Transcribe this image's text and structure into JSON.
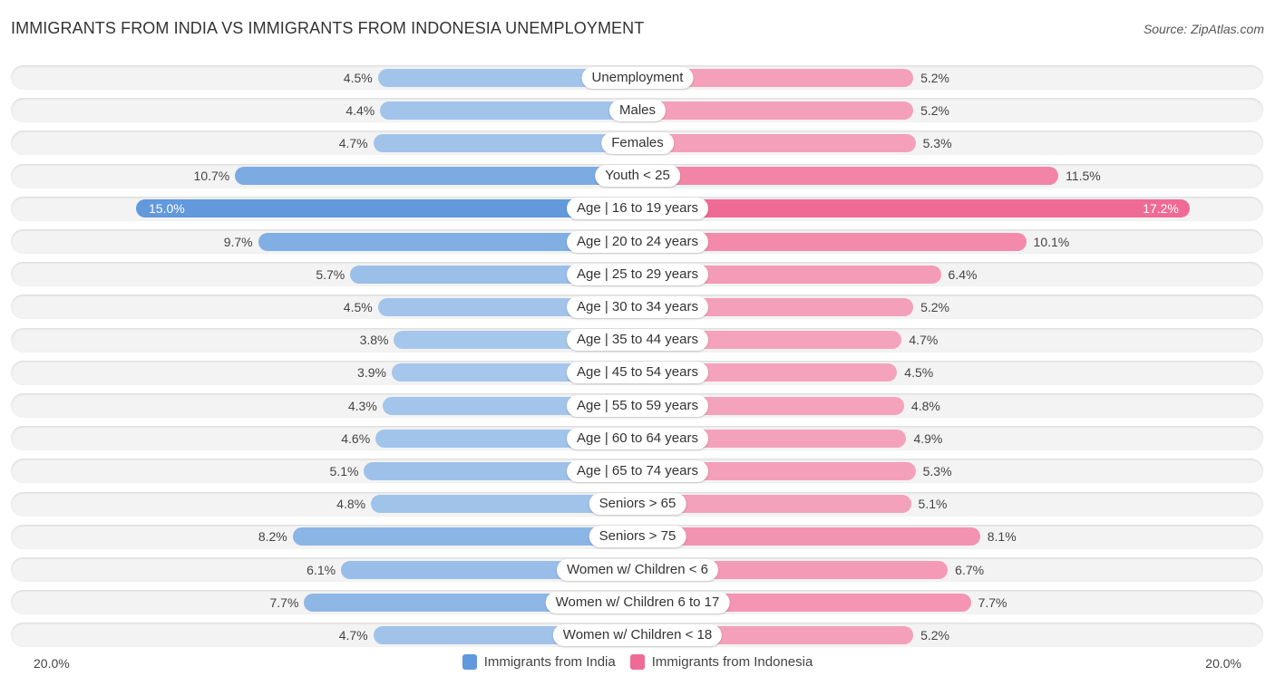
{
  "header": {
    "title": "IMMIGRANTS FROM INDIA VS IMMIGRANTS FROM INDONESIA UNEMPLOYMENT",
    "source": "Source: ZipAtlas.com"
  },
  "colors": {
    "india_light": "#a8c8ec",
    "india_strong": "#6199dc",
    "indonesia_light": "#f5a8c0",
    "indonesia_strong": "#f06a96"
  },
  "chart_data": {
    "type": "bar",
    "orientation": "horizontal-diverging",
    "title": "IMMIGRANTS FROM INDIA VS IMMIGRANTS FROM INDONESIA UNEMPLOYMENT",
    "xlabel": "",
    "ylabel": "",
    "unit": "%",
    "axis_min_label": "20.0%",
    "axis_max_label": "20.0%",
    "xlim": [
      0,
      20
    ],
    "legend_position": "bottom-center",
    "grid": false,
    "categories": [
      "Unemployment",
      "Males",
      "Females",
      "Youth < 25",
      "Age | 16 to 19 years",
      "Age | 20 to 24 years",
      "Age | 25 to 29 years",
      "Age | 30 to 34 years",
      "Age | 35 to 44 years",
      "Age | 45 to 54 years",
      "Age | 55 to 59 years",
      "Age | 60 to 64 years",
      "Age | 65 to 74 years",
      "Seniors > 65",
      "Seniors > 75",
      "Women w/ Children < 6",
      "Women w/ Children 6 to 17",
      "Women w/ Children < 18"
    ],
    "series": [
      {
        "name": "Immigrants from India",
        "side": "left",
        "values": [
          4.5,
          4.4,
          4.7,
          10.7,
          15.0,
          9.7,
          5.7,
          4.5,
          3.8,
          3.9,
          4.3,
          4.6,
          5.1,
          4.8,
          8.2,
          6.1,
          7.7,
          4.7
        ],
        "labels": [
          "4.5%",
          "4.4%",
          "4.7%",
          "10.7%",
          "15.0%",
          "9.7%",
          "5.7%",
          "4.5%",
          "3.8%",
          "3.9%",
          "4.3%",
          "4.6%",
          "5.1%",
          "4.8%",
          "8.2%",
          "6.1%",
          "7.7%",
          "4.7%"
        ]
      },
      {
        "name": "Immigrants from Indonesia",
        "side": "right",
        "values": [
          5.2,
          5.2,
          5.3,
          11.5,
          17.2,
          10.1,
          6.4,
          5.2,
          4.7,
          4.5,
          4.8,
          4.9,
          5.3,
          5.1,
          8.1,
          6.7,
          7.7,
          5.2
        ],
        "labels": [
          "5.2%",
          "5.2%",
          "5.3%",
          "11.5%",
          "17.2%",
          "10.1%",
          "6.4%",
          "5.2%",
          "4.7%",
          "4.5%",
          "4.8%",
          "4.9%",
          "5.3%",
          "5.1%",
          "8.1%",
          "6.7%",
          "7.7%",
          "5.2%"
        ]
      }
    ]
  },
  "legend": {
    "items": [
      {
        "label": "Immigrants from India",
        "color": "#6199dc"
      },
      {
        "label": "Immigrants from Indonesia",
        "color": "#f06a96"
      }
    ]
  }
}
